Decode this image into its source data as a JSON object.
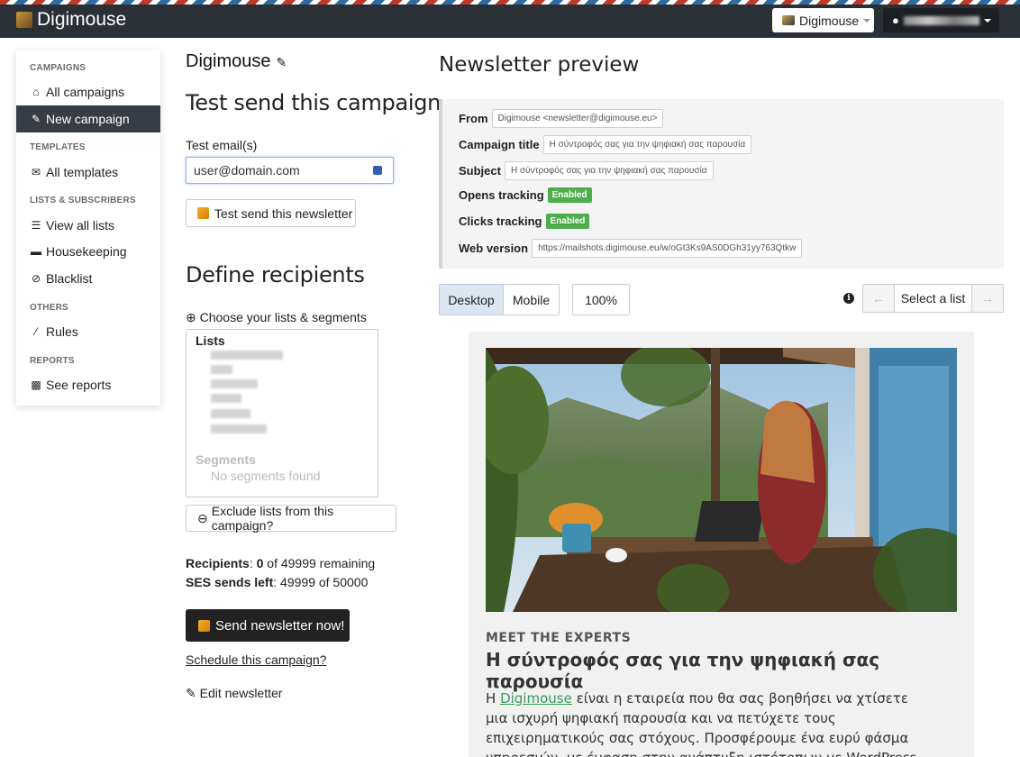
{
  "topbar": {
    "brand": "Digimouse",
    "app_selector": "Digimouse"
  },
  "sidebar": {
    "sections": [
      {
        "head": "CAMPAIGNS"
      },
      {
        "head": "TEMPLATES"
      },
      {
        "head": "LISTS & SUBSCRIBERS"
      },
      {
        "head": "OTHERS"
      },
      {
        "head": "REPORTS"
      }
    ],
    "items": [
      {
        "label": "All campaigns"
      },
      {
        "label": "New campaign"
      },
      {
        "label": "All templates"
      },
      {
        "label": "View all lists"
      },
      {
        "label": "Housekeeping"
      },
      {
        "label": "Blacklist"
      },
      {
        "label": "Rules"
      },
      {
        "label": "See reports"
      }
    ]
  },
  "campaign": {
    "name": "Digimouse",
    "test_send_heading": "Test send this campaign",
    "test_email_label": "Test email(s)",
    "test_email_value": "user@domain.com",
    "test_send_button": "Test send this newsletter",
    "define_heading": "Define recipients",
    "choose_label": "Choose your lists & segments",
    "lists_head": "Lists",
    "segments_head": "Segments",
    "segments_none": "No segments found",
    "exclude_button": "Exclude lists from this campaign?",
    "recipients_label": "Recipients",
    "recipients_count": "0",
    "recipients_rest": "of 49999 remaining",
    "ses_label": "SES sends left",
    "ses_value": "49999 of 50000",
    "send_now_button": "Send newsletter now!",
    "schedule_link": "Schedule this campaign?",
    "edit_link": "Edit newsletter"
  },
  "preview": {
    "title": "Newsletter preview",
    "from_label": "From",
    "from_value": "Digimouse <newsletter@digimouse.eu>",
    "campaign_title_label": "Campaign title",
    "campaign_title_value": "Η σύντροφός σας για την ψηφιακή σας παρουσία",
    "subject_label": "Subject",
    "subject_value": "Η σύντροφός σας για την ψηφιακή σας παρουσία",
    "opens_label": "Opens tracking",
    "opens_value": "Enabled",
    "clicks_label": "Clicks tracking",
    "clicks_value": "Enabled",
    "web_label": "Web version",
    "web_value": "https://mailshots.digimouse.eu/w/oGt3Ks9AS0DGh31yy763Qtkw",
    "desktop": "Desktop",
    "mobile": "Mobile",
    "zoom": "100%",
    "select_list": "Select a list"
  },
  "email": {
    "kicker": "MEET THE EXPERTS",
    "heading": "Η σύντροφός σας για την ψηφιακή σας παρουσία",
    "p_prefix": "Η ",
    "p_link": "Digimouse",
    "p_rest": " είναι η εταιρεία που θα σας βοηθήσει να χτίσετε μια ισχυρή ψηφιακή παρουσία και να πετύχετε τους επιχειρηματικούς σας στόχους. Προσφέρουμε ένα ευρύ φάσμα υπηρεσιών, με έμφαση στην ανάπτυξη ιστότοπων με WordPress και Elementor, καθώς και στην αποστολή HTML"
  }
}
